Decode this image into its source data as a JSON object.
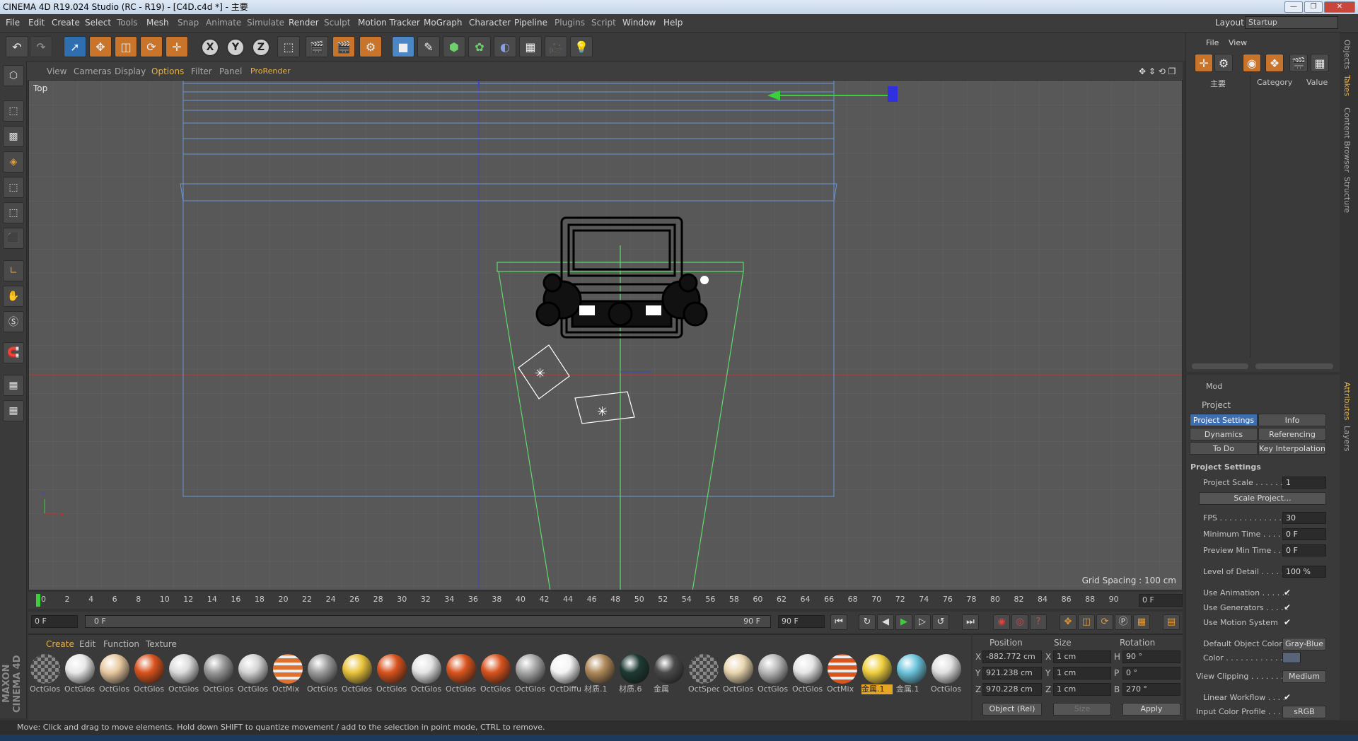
{
  "window": {
    "title": "CINEMA 4D R19.024 Studio (RC - R19) - [C4D.c4d *] - 主要",
    "layout_label": "Layout:",
    "layout_value": "Startup"
  },
  "menu": [
    "File",
    "Edit",
    "Create",
    "Select",
    "Tools",
    "Mesh",
    "Snap",
    "Animate",
    "Simulate",
    "Render",
    "Sculpt",
    "Motion Tracker",
    "MoGraph",
    "Character",
    "Pipeline",
    "Plugins",
    "Script",
    "Window",
    "Help"
  ],
  "viewport": {
    "menu": [
      "View",
      "Cameras",
      "Display",
      "Options",
      "Filter",
      "Panel",
      "ProRender"
    ],
    "active_menu": "Options",
    "label": "Top",
    "grid_spacing": "Grid Spacing : 100 cm"
  },
  "timeline": {
    "ticks": [
      "0",
      "2",
      "4",
      "6",
      "8",
      "10",
      "12",
      "14",
      "16",
      "18",
      "20",
      "22",
      "24",
      "26",
      "28",
      "30",
      "32",
      "34",
      "36",
      "38",
      "40",
      "42",
      "44",
      "46",
      "48",
      "50",
      "52",
      "54",
      "56",
      "58",
      "60",
      "62",
      "64",
      "66",
      "68",
      "70",
      "72",
      "74",
      "76",
      "78",
      "80",
      "82",
      "84",
      "86",
      "88",
      "90"
    ],
    "current_frame": "0 F",
    "start": "0 F",
    "range_start": "0 F",
    "range_end": "90 F",
    "end": "90 F"
  },
  "materials": {
    "menu": [
      "Create",
      "Edit",
      "Function",
      "Texture"
    ],
    "items": [
      {
        "name": "OctGlos",
        "color": "#2a2a2a",
        "type": "checker"
      },
      {
        "name": "OctGlos",
        "color": "#e8e8e8"
      },
      {
        "name": "OctGlos",
        "color": "#e8c9a0"
      },
      {
        "name": "OctGlos",
        "color": "#d9541e"
      },
      {
        "name": "OctGlos",
        "color": "#dcdcdc"
      },
      {
        "name": "OctGlos",
        "color": "#9a9a9a"
      },
      {
        "name": "OctGlos",
        "color": "#d4d4d4"
      },
      {
        "name": "OctMix",
        "color": "#e07030",
        "type": "mix"
      },
      {
        "name": "OctGlos",
        "color": "#9d9d9d"
      },
      {
        "name": "OctGlos",
        "color": "#e9c43c"
      },
      {
        "name": "OctGlos",
        "color": "#d9541e"
      },
      {
        "name": "OctGlos",
        "color": "#e4e4e4"
      },
      {
        "name": "OctGlos",
        "color": "#d9541e"
      },
      {
        "name": "OctGlos",
        "color": "#d9541e"
      },
      {
        "name": "OctGlos",
        "color": "#a8a8a8"
      },
      {
        "name": "OctDiffu",
        "color": "#f4f4f4"
      },
      {
        "name": "材质.1",
        "color": "#b08a5a"
      },
      {
        "name": "材质.6",
        "color": "#1e3a34"
      },
      {
        "name": "金属",
        "color": "#4a4a4a"
      },
      {
        "name": "OctSpec",
        "color": "#888888",
        "type": "checker"
      },
      {
        "name": "OctGlos",
        "color": "#ead7b0"
      },
      {
        "name": "OctGlos",
        "color": "#b8b8b8"
      },
      {
        "name": "OctGlos",
        "color": "#e6e6e6"
      },
      {
        "name": "OctMix",
        "color": "#d9541e",
        "type": "mix"
      },
      {
        "name": "金属.1",
        "color": "#f0d040",
        "selected": true
      },
      {
        "name": "金属.1",
        "color": "#6cc4dc"
      },
      {
        "name": "OctGlos",
        "color": "#e0e0e0"
      }
    ]
  },
  "coords": {
    "headers": [
      "Position",
      "Size",
      "Rotation"
    ],
    "rows": [
      {
        "axis": "X",
        "pos": "-882.772 cm",
        "size_axis": "X",
        "size": "1 cm",
        "rot_axis": "H",
        "rot": "90 °"
      },
      {
        "axis": "Y",
        "pos": "921.238 cm",
        "size_axis": "Y",
        "size": "1 cm",
        "rot_axis": "P",
        "rot": "0 °"
      },
      {
        "axis": "Z",
        "pos": "970.228 cm",
        "size_axis": "Z",
        "size": "1 cm",
        "rot_axis": "B",
        "rot": "270 °"
      }
    ],
    "mode": "Object (Rel)",
    "size_mode": "Size",
    "apply": "Apply"
  },
  "objects_panel": {
    "menu": [
      "File",
      "View"
    ],
    "col_name": "主要",
    "col_category": "Category",
    "col_value": "Value"
  },
  "attributes": {
    "mode": "Mod",
    "object": "Project",
    "tabs": [
      "Project Settings",
      "Info",
      "Dynamics",
      "Referencing",
      "To Do",
      "Key Interpolation"
    ],
    "section": "Project Settings",
    "props": [
      {
        "label": "Project Scale . . . . . . .",
        "value": "1"
      },
      {
        "label": "FPS . . . . . . . . . . . . . .",
        "value": "30"
      },
      {
        "label": "Minimum Time . . . . .",
        "value": "0 F"
      },
      {
        "label": "Preview Min Time . . .",
        "value": "0 F"
      },
      {
        "label": "Level of Detail . . . . .",
        "value": "100 %"
      }
    ],
    "scale_button": "Scale Project...",
    "checks": [
      {
        "label": "Use Animation . . . . . .",
        "checked": true
      },
      {
        "label": "Use Generators . . . . .",
        "checked": true
      },
      {
        "label": "Use Motion System",
        "checked": true
      }
    ],
    "default_color_label": "Default Object Color",
    "default_color_value": "Gray-Blue",
    "color_label": "Color . . . . . . . . . . . . .",
    "view_clipping_label": "View Clipping . . . . . . .",
    "view_clipping_value": "Medium",
    "linear_workflow_label": "Linear Workflow . . . .",
    "input_profile_label": "Input Color Profile . . .",
    "input_profile_value": "sRGB"
  },
  "side_tabs": [
    "Objects",
    "Takes",
    "Content Browser",
    "Structure",
    "Attributes",
    "Layers"
  ],
  "status": "Move: Click and drag to move elements. Hold down SHIFT to quantize movement / add to the selection in point mode, CTRL to remove.",
  "logo": "MAXON CINEMA 4D"
}
